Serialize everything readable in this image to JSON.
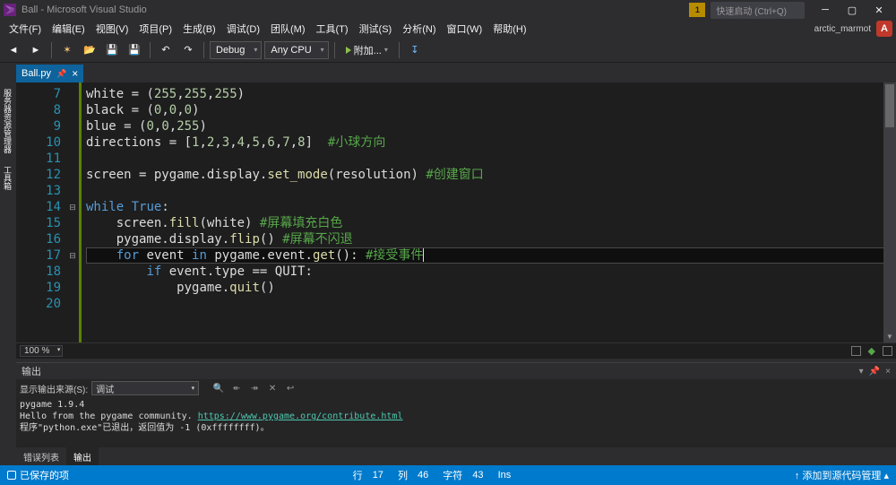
{
  "title": "Ball - Microsoft Visual Studio",
  "notif_count": "1",
  "quick_launch": "快速启动 (Ctrl+Q)",
  "user": {
    "name": "arctic_marmot",
    "initial": "A"
  },
  "menu": [
    "文件(F)",
    "编辑(E)",
    "视图(V)",
    "项目(P)",
    "生成(B)",
    "调试(D)",
    "团队(M)",
    "工具(T)",
    "测试(S)",
    "分析(N)",
    "窗口(W)",
    "帮助(H)"
  ],
  "toolbar": {
    "config": "Debug",
    "platform": "Any CPU",
    "start": "附加..."
  },
  "left_rail": [
    "服务器资源管理器",
    "工具箱"
  ],
  "tab": {
    "name": "Ball.py",
    "pinned": true
  },
  "zoom": "100 %",
  "code": {
    "lines": [
      {
        "n": 7,
        "seg": [
          [
            "id",
            "white"
          ],
          [
            "op",
            " = "
          ],
          [
            "pn",
            "("
          ],
          [
            "num",
            "255"
          ],
          [
            "pn",
            ","
          ],
          [
            "num",
            "255"
          ],
          [
            "pn",
            ","
          ],
          [
            "num",
            "255"
          ],
          [
            "pn",
            ")"
          ]
        ]
      },
      {
        "n": 8,
        "seg": [
          [
            "id",
            "black"
          ],
          [
            "op",
            " = "
          ],
          [
            "pn",
            "("
          ],
          [
            "num",
            "0"
          ],
          [
            "pn",
            ","
          ],
          [
            "num",
            "0"
          ],
          [
            "pn",
            ","
          ],
          [
            "num",
            "0"
          ],
          [
            "pn",
            ")"
          ]
        ]
      },
      {
        "n": 9,
        "seg": [
          [
            "id",
            "blue"
          ],
          [
            "op",
            " = "
          ],
          [
            "pn",
            "("
          ],
          [
            "num",
            "0"
          ],
          [
            "pn",
            ","
          ],
          [
            "num",
            "0"
          ],
          [
            "pn",
            ","
          ],
          [
            "num",
            "255"
          ],
          [
            "pn",
            ")"
          ]
        ]
      },
      {
        "n": 10,
        "seg": [
          [
            "id",
            "directions"
          ],
          [
            "op",
            " = "
          ],
          [
            "pn",
            "["
          ],
          [
            "num",
            "1"
          ],
          [
            "pn",
            ","
          ],
          [
            "num",
            "2"
          ],
          [
            "pn",
            ","
          ],
          [
            "num",
            "3"
          ],
          [
            "pn",
            ","
          ],
          [
            "num",
            "4"
          ],
          [
            "pn",
            ","
          ],
          [
            "num",
            "5"
          ],
          [
            "pn",
            ","
          ],
          [
            "num",
            "6"
          ],
          [
            "pn",
            ","
          ],
          [
            "num",
            "7"
          ],
          [
            "pn",
            ","
          ],
          [
            "num",
            "8"
          ],
          [
            "pn",
            "]  "
          ],
          [
            "cmt",
            "#小球方向"
          ]
        ]
      },
      {
        "n": 11,
        "seg": []
      },
      {
        "n": 12,
        "seg": [
          [
            "id",
            "screen"
          ],
          [
            "op",
            " = "
          ],
          [
            "id",
            "pygame"
          ],
          [
            "pn",
            "."
          ],
          [
            "id",
            "display"
          ],
          [
            "pn",
            "."
          ],
          [
            "fn",
            "set_mode"
          ],
          [
            "pn",
            "("
          ],
          [
            "id",
            "resolution"
          ],
          [
            "pn",
            ") "
          ],
          [
            "cmt",
            "#创建窗口"
          ]
        ]
      },
      {
        "n": 13,
        "seg": []
      },
      {
        "n": 14,
        "fold": "-",
        "seg": [
          [
            "kw",
            "while"
          ],
          [
            "op",
            " "
          ],
          [
            "kw",
            "True"
          ],
          [
            "pn",
            ":"
          ]
        ]
      },
      {
        "n": 15,
        "indent": 1,
        "seg": [
          [
            "id",
            "screen"
          ],
          [
            "pn",
            "."
          ],
          [
            "fn",
            "fill"
          ],
          [
            "pn",
            "("
          ],
          [
            "id",
            "white"
          ],
          [
            "pn",
            ") "
          ],
          [
            "cmt",
            "#屏幕填充白色"
          ]
        ]
      },
      {
        "n": 16,
        "indent": 1,
        "seg": [
          [
            "id",
            "pygame"
          ],
          [
            "pn",
            "."
          ],
          [
            "id",
            "display"
          ],
          [
            "pn",
            "."
          ],
          [
            "fn",
            "flip"
          ],
          [
            "pn",
            "() "
          ],
          [
            "cmt",
            "#屏幕不闪退"
          ]
        ]
      },
      {
        "n": 17,
        "indent": 1,
        "hl": true,
        "fold": "-",
        "seg": [
          [
            "kw",
            "for"
          ],
          [
            "op",
            " "
          ],
          [
            "id",
            "event"
          ],
          [
            "op",
            " "
          ],
          [
            "kw",
            "in"
          ],
          [
            "op",
            " "
          ],
          [
            "id",
            "pygame"
          ],
          [
            "pn",
            "."
          ],
          [
            "id",
            "event"
          ],
          [
            "pn",
            "."
          ],
          [
            "fn",
            "get"
          ],
          [
            "pn",
            "(): "
          ],
          [
            "cmt",
            "#接受事件"
          ]
        ],
        "caret": true
      },
      {
        "n": 18,
        "indent": 2,
        "seg": [
          [
            "kw",
            "if"
          ],
          [
            "op",
            " "
          ],
          [
            "id",
            "event"
          ],
          [
            "pn",
            "."
          ],
          [
            "id",
            "type"
          ],
          [
            "op",
            " == "
          ],
          [
            "id",
            "QUIT"
          ],
          [
            "pn",
            ":"
          ]
        ]
      },
      {
        "n": 19,
        "indent": 3,
        "seg": [
          [
            "id",
            "pygame"
          ],
          [
            "pn",
            "."
          ],
          [
            "fn",
            "quit"
          ],
          [
            "pn",
            "()"
          ]
        ]
      },
      {
        "n": 20,
        "seg": []
      }
    ]
  },
  "output": {
    "title": "输出",
    "source_label": "显示输出来源(S):",
    "source_value": "调试",
    "lines": [
      {
        "t": "pygame 1.9.4"
      },
      {
        "t": "Hello from the pygame community. ",
        "link": "https://www.pygame.org/contribute.html"
      },
      {
        "t": "程序\"python.exe\"已退出，返回值为 -1 (0xffffffff)。"
      }
    ]
  },
  "bottom_tabs": [
    "错误列表",
    "输出"
  ],
  "status": {
    "left": "已保存的项",
    "ln_label": "行",
    "ln": "17",
    "col_label": "列",
    "col": "46",
    "ch_label": "字符",
    "ch": "43",
    "ins": "Ins",
    "right": "↑ 添加到源代码管理 ▴"
  }
}
